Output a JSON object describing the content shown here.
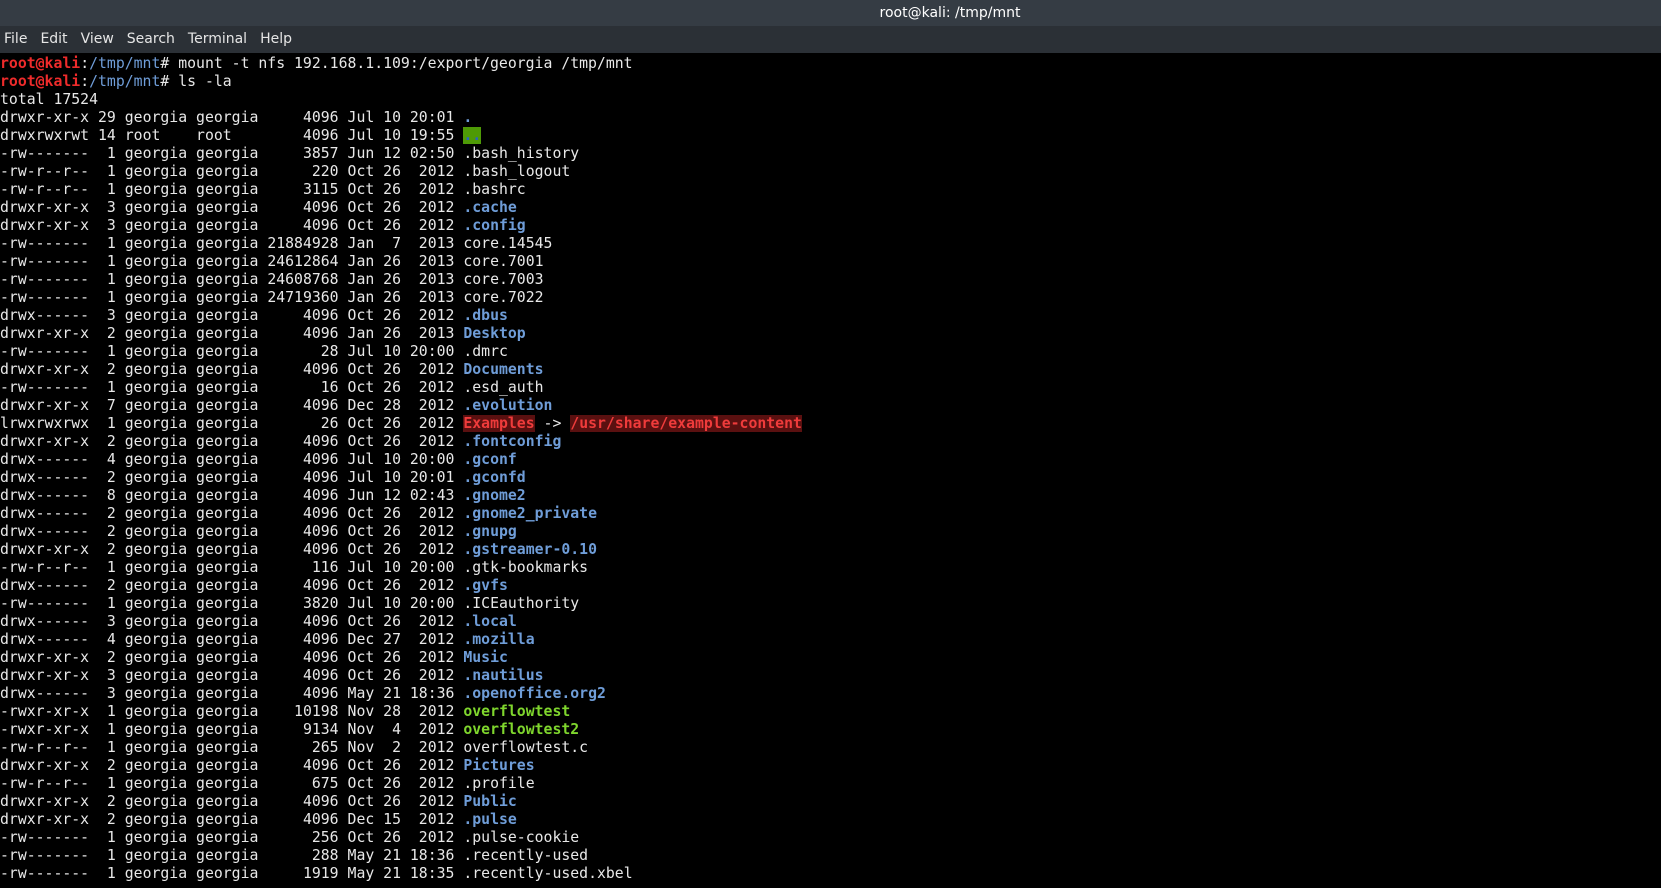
{
  "window": {
    "title": "root@kali: /tmp/mnt"
  },
  "menu": {
    "items": [
      "File",
      "Edit",
      "View",
      "Search",
      "Terminal",
      "Help"
    ]
  },
  "colors": {
    "titlebar_bg": "#353c44",
    "menubar_bg": "#2b3036",
    "terminal_bg": "#000000",
    "prompt_user": "#ef2b2b",
    "prompt_path": "#6f9dd8",
    "directory": "#6f9dd8",
    "executable": "#7fd62d",
    "sticky_bg": "#4e9a06",
    "broken_link": "#ef3b3b"
  },
  "terminal": {
    "commands": [
      {
        "user": "root@kali",
        "sep": ":",
        "path": "/tmp/mnt",
        "symbol": "# ",
        "text": "mount -t nfs 192.168.1.109:/export/georgia /tmp/mnt"
      },
      {
        "user": "root@kali",
        "sep": ":",
        "path": "/tmp/mnt",
        "symbol": "# ",
        "text": "ls -la"
      }
    ],
    "total": "total 17524",
    "entries": [
      {
        "perm": "drwxr-xr-x",
        "links": "29",
        "owner": "georgia",
        "group": "georgia",
        "size": "4096",
        "date": "Jul 10 20:01",
        "name": ".",
        "type": "dir"
      },
      {
        "perm": "drwxrwxrwt",
        "links": "14",
        "owner": "root",
        "group": "root",
        "size": "4096",
        "date": "Jul 10 19:55",
        "name": "..",
        "type": "sticky"
      },
      {
        "perm": "-rw-------",
        "links": "1",
        "owner": "georgia",
        "group": "georgia",
        "size": "3857",
        "date": "Jun 12 02:50",
        "name": ".bash_history",
        "type": "file"
      },
      {
        "perm": "-rw-r--r--",
        "links": "1",
        "owner": "georgia",
        "group": "georgia",
        "size": "220",
        "date": "Oct 26  2012",
        "name": ".bash_logout",
        "type": "file"
      },
      {
        "perm": "-rw-r--r--",
        "links": "1",
        "owner": "georgia",
        "group": "georgia",
        "size": "3115",
        "date": "Oct 26  2012",
        "name": ".bashrc",
        "type": "file"
      },
      {
        "perm": "drwxr-xr-x",
        "links": "3",
        "owner": "georgia",
        "group": "georgia",
        "size": "4096",
        "date": "Oct 26  2012",
        "name": ".cache",
        "type": "dir"
      },
      {
        "perm": "drwxr-xr-x",
        "links": "3",
        "owner": "georgia",
        "group": "georgia",
        "size": "4096",
        "date": "Oct 26  2012",
        "name": ".config",
        "type": "dir"
      },
      {
        "perm": "-rw-------",
        "links": "1",
        "owner": "georgia",
        "group": "georgia",
        "size": "21884928",
        "date": "Jan  7  2013",
        "name": "core.14545",
        "type": "file"
      },
      {
        "perm": "-rw-------",
        "links": "1",
        "owner": "georgia",
        "group": "georgia",
        "size": "24612864",
        "date": "Jan 26  2013",
        "name": "core.7001",
        "type": "file"
      },
      {
        "perm": "-rw-------",
        "links": "1",
        "owner": "georgia",
        "group": "georgia",
        "size": "24608768",
        "date": "Jan 26  2013",
        "name": "core.7003",
        "type": "file"
      },
      {
        "perm": "-rw-------",
        "links": "1",
        "owner": "georgia",
        "group": "georgia",
        "size": "24719360",
        "date": "Jan 26  2013",
        "name": "core.7022",
        "type": "file"
      },
      {
        "perm": "drwx------",
        "links": "3",
        "owner": "georgia",
        "group": "georgia",
        "size": "4096",
        "date": "Oct 26  2012",
        "name": ".dbus",
        "type": "dir"
      },
      {
        "perm": "drwxr-xr-x",
        "links": "2",
        "owner": "georgia",
        "group": "georgia",
        "size": "4096",
        "date": "Jan 26  2013",
        "name": "Desktop",
        "type": "dir"
      },
      {
        "perm": "-rw-------",
        "links": "1",
        "owner": "georgia",
        "group": "georgia",
        "size": "28",
        "date": "Jul 10 20:00",
        "name": ".dmrc",
        "type": "file"
      },
      {
        "perm": "drwxr-xr-x",
        "links": "2",
        "owner": "georgia",
        "group": "georgia",
        "size": "4096",
        "date": "Oct 26  2012",
        "name": "Documents",
        "type": "dir"
      },
      {
        "perm": "-rw-------",
        "links": "1",
        "owner": "georgia",
        "group": "georgia",
        "size": "16",
        "date": "Oct 26  2012",
        "name": ".esd_auth",
        "type": "file"
      },
      {
        "perm": "drwxr-xr-x",
        "links": "7",
        "owner": "georgia",
        "group": "georgia",
        "size": "4096",
        "date": "Dec 28  2012",
        "name": ".evolution",
        "type": "dir"
      },
      {
        "perm": "lrwxrwxrwx",
        "links": "1",
        "owner": "georgia",
        "group": "georgia",
        "size": "26",
        "date": "Oct 26  2012",
        "name": "Examples",
        "type": "link",
        "arrow": " -> ",
        "target": "/usr/share/example-content"
      },
      {
        "perm": "drwxr-xr-x",
        "links": "2",
        "owner": "georgia",
        "group": "georgia",
        "size": "4096",
        "date": "Oct 26  2012",
        "name": ".fontconfig",
        "type": "dir"
      },
      {
        "perm": "drwx------",
        "links": "4",
        "owner": "georgia",
        "group": "georgia",
        "size": "4096",
        "date": "Jul 10 20:00",
        "name": ".gconf",
        "type": "dir"
      },
      {
        "perm": "drwx------",
        "links": "2",
        "owner": "georgia",
        "group": "georgia",
        "size": "4096",
        "date": "Jul 10 20:01",
        "name": ".gconfd",
        "type": "dir"
      },
      {
        "perm": "drwx------",
        "links": "8",
        "owner": "georgia",
        "group": "georgia",
        "size": "4096",
        "date": "Jun 12 02:43",
        "name": ".gnome2",
        "type": "dir"
      },
      {
        "perm": "drwx------",
        "links": "2",
        "owner": "georgia",
        "group": "georgia",
        "size": "4096",
        "date": "Oct 26  2012",
        "name": ".gnome2_private",
        "type": "dir"
      },
      {
        "perm": "drwx------",
        "links": "2",
        "owner": "georgia",
        "group": "georgia",
        "size": "4096",
        "date": "Oct 26  2012",
        "name": ".gnupg",
        "type": "dir"
      },
      {
        "perm": "drwxr-xr-x",
        "links": "2",
        "owner": "georgia",
        "group": "georgia",
        "size": "4096",
        "date": "Oct 26  2012",
        "name": ".gstreamer-0.10",
        "type": "dir"
      },
      {
        "perm": "-rw-r--r--",
        "links": "1",
        "owner": "georgia",
        "group": "georgia",
        "size": "116",
        "date": "Jul 10 20:00",
        "name": ".gtk-bookmarks",
        "type": "file"
      },
      {
        "perm": "drwx------",
        "links": "2",
        "owner": "georgia",
        "group": "georgia",
        "size": "4096",
        "date": "Oct 26  2012",
        "name": ".gvfs",
        "type": "dir"
      },
      {
        "perm": "-rw-------",
        "links": "1",
        "owner": "georgia",
        "group": "georgia",
        "size": "3820",
        "date": "Jul 10 20:00",
        "name": ".ICEauthority",
        "type": "file"
      },
      {
        "perm": "drwx------",
        "links": "3",
        "owner": "georgia",
        "group": "georgia",
        "size": "4096",
        "date": "Oct 26  2012",
        "name": ".local",
        "type": "dir"
      },
      {
        "perm": "drwx------",
        "links": "4",
        "owner": "georgia",
        "group": "georgia",
        "size": "4096",
        "date": "Dec 27  2012",
        "name": ".mozilla",
        "type": "dir"
      },
      {
        "perm": "drwxr-xr-x",
        "links": "2",
        "owner": "georgia",
        "group": "georgia",
        "size": "4096",
        "date": "Oct 26  2012",
        "name": "Music",
        "type": "dir"
      },
      {
        "perm": "drwxr-xr-x",
        "links": "3",
        "owner": "georgia",
        "group": "georgia",
        "size": "4096",
        "date": "Oct 26  2012",
        "name": ".nautilus",
        "type": "dir"
      },
      {
        "perm": "drwx------",
        "links": "3",
        "owner": "georgia",
        "group": "georgia",
        "size": "4096",
        "date": "May 21 18:36",
        "name": ".openoffice.org2",
        "type": "dir"
      },
      {
        "perm": "-rwxr-xr-x",
        "links": "1",
        "owner": "georgia",
        "group": "georgia",
        "size": "10198",
        "date": "Nov 28  2012",
        "name": "overflowtest",
        "type": "exec"
      },
      {
        "perm": "-rwxr-xr-x",
        "links": "1",
        "owner": "georgia",
        "group": "georgia",
        "size": "9134",
        "date": "Nov  4  2012",
        "name": "overflowtest2",
        "type": "exec"
      },
      {
        "perm": "-rw-r--r--",
        "links": "1",
        "owner": "georgia",
        "group": "georgia",
        "size": "265",
        "date": "Nov  2  2012",
        "name": "overflowtest.c",
        "type": "file"
      },
      {
        "perm": "drwxr-xr-x",
        "links": "2",
        "owner": "georgia",
        "group": "georgia",
        "size": "4096",
        "date": "Oct 26  2012",
        "name": "Pictures",
        "type": "dir"
      },
      {
        "perm": "-rw-r--r--",
        "links": "1",
        "owner": "georgia",
        "group": "georgia",
        "size": "675",
        "date": "Oct 26  2012",
        "name": ".profile",
        "type": "file"
      },
      {
        "perm": "drwxr-xr-x",
        "links": "2",
        "owner": "georgia",
        "group": "georgia",
        "size": "4096",
        "date": "Oct 26  2012",
        "name": "Public",
        "type": "dir"
      },
      {
        "perm": "drwxr-xr-x",
        "links": "2",
        "owner": "georgia",
        "group": "georgia",
        "size": "4096",
        "date": "Dec 15  2012",
        "name": ".pulse",
        "type": "dir"
      },
      {
        "perm": "-rw-------",
        "links": "1",
        "owner": "georgia",
        "group": "georgia",
        "size": "256",
        "date": "Oct 26  2012",
        "name": ".pulse-cookie",
        "type": "file"
      },
      {
        "perm": "-rw-------",
        "links": "1",
        "owner": "georgia",
        "group": "georgia",
        "size": "288",
        "date": "May 21 18:36",
        "name": ".recently-used",
        "type": "file"
      },
      {
        "perm": "-rw-------",
        "links": "1",
        "owner": "georgia",
        "group": "georgia",
        "size": "1919",
        "date": "May 21 18:35",
        "name": ".recently-used.xbel",
        "type": "file"
      }
    ]
  }
}
